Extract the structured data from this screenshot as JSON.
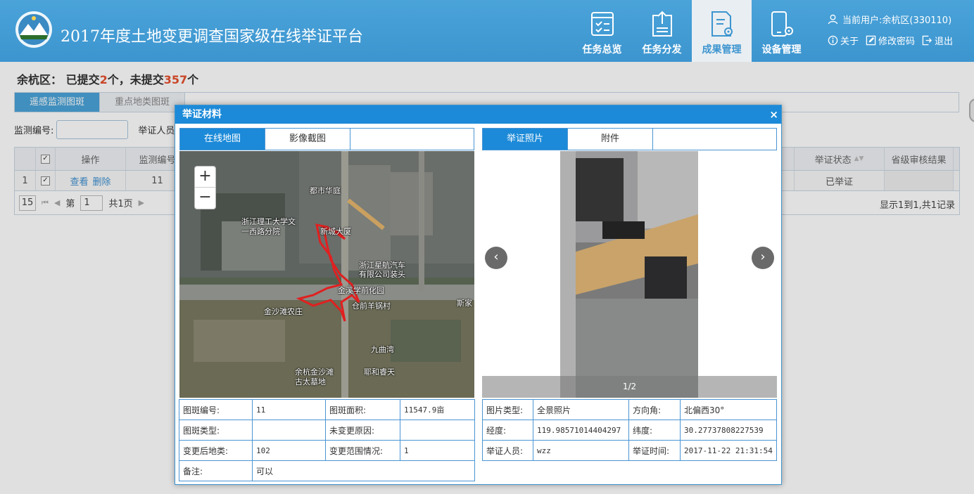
{
  "header": {
    "title": "2017年度土地变更调查国家级在线举证平台",
    "nav": [
      {
        "label": "任务总览",
        "icon": "task-overview-icon"
      },
      {
        "label": "任务分发",
        "icon": "task-distribute-icon"
      },
      {
        "label": "成果管理",
        "icon": "result-manage-icon"
      },
      {
        "label": "设备管理",
        "icon": "device-manage-icon"
      }
    ],
    "current_user": "当前用户:余杭区(330110)",
    "about": "关于",
    "change_password": "修改密码",
    "logout": "退出",
    "accent": "#3d95cf"
  },
  "summary": {
    "region": "余杭区：",
    "submitted_prefix": "已提交",
    "submitted_count": "2",
    "submitted_unit": "个，未提交",
    "unsubmitted_count": "357",
    "unsubmitted_unit": "个"
  },
  "tabs": [
    "遥感监测图斑",
    "重点地类图斑"
  ],
  "filter": {
    "monitor_label": "监测编号:",
    "person_label": "举证人员"
  },
  "grid": {
    "headers": {
      "op": "操作",
      "monitor_no": "监测编号",
      "status": "举证状态",
      "review": "省级审核结果"
    },
    "row": {
      "index": "1",
      "view": "查看",
      "delete": "删除",
      "monitor_no": "11",
      "status": "已举证",
      "review": ""
    },
    "pager": {
      "page_size": "15",
      "page_prefix": "第",
      "page": "1",
      "page_suffix": "共1页",
      "info": "显示1到1,共1记录"
    }
  },
  "modal": {
    "title": "举证材料",
    "close": "×",
    "left_tabs": [
      "在线地图",
      "影像截图"
    ],
    "right_tabs": [
      "举证照片",
      "附件"
    ],
    "map_labels": [
      "都市华庭",
      "浙江理工大学文",
      "一西路分院",
      "新城大厦",
      "浙江星航汽车",
      "有限公司装头",
      "金溪学前化园",
      "金沙滩农庄",
      "仓前羊锅村",
      "九曲湾",
      "余杭金沙滩",
      "古太墓地",
      "耶和睿天",
      "斯家"
    ],
    "zoom_in": "+",
    "zoom_out": "−",
    "photo_counter": "1/2",
    "prev": "‹",
    "next": "›",
    "patch_info": {
      "patch_no_label": "图斑编号:",
      "patch_no": "11",
      "area_label": "图斑面积:",
      "area": "11547.9亩",
      "type_label": "图斑类型:",
      "type": "",
      "reason_label": "未变更原因:",
      "reason": "",
      "new_class_label": "变更后地类:",
      "new_class": "102",
      "scope_label": "变更范围情况:",
      "scope": "1",
      "remark_label": "备注:",
      "remark": "可以"
    },
    "photo_info": {
      "img_type_label": "图片类型:",
      "img_type": "全景照片",
      "azimuth_label": "方向角:",
      "azimuth": "北偏西30°",
      "lon_label": "经度:",
      "lon": "119.98571014404297",
      "lat_label": "纬度:",
      "lat": "30.27737808227539",
      "person_label": "举证人员:",
      "person": "wzz",
      "time_label": "举证时间:",
      "time": "2017-11-22 21:31:54"
    }
  }
}
